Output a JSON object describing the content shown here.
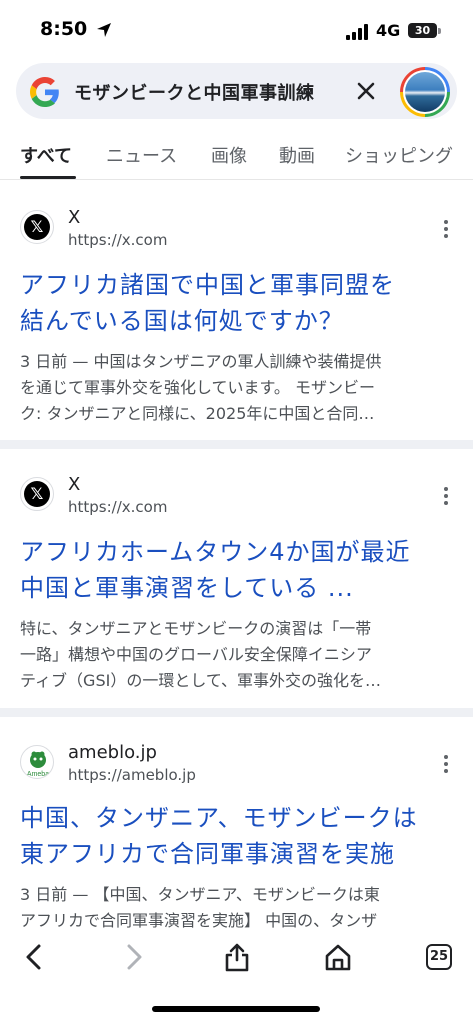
{
  "status_bar": {
    "time": "8:50",
    "network": "4G",
    "battery": "30"
  },
  "search": {
    "query": "モザンビークと中国軍事訓練",
    "logo_icon": "google-g-icon",
    "clear_icon": "close-icon"
  },
  "tabs": [
    {
      "label": "すべて",
      "active": true
    },
    {
      "label": "ニュース",
      "active": false
    },
    {
      "label": "画像",
      "active": false
    },
    {
      "label": "動画",
      "active": false
    },
    {
      "label": "ショッピング",
      "active": false
    }
  ],
  "results": [
    {
      "site_name": "X",
      "site_url": "https://x.com",
      "title_line1": "アフリカ諸国で中国と軍事同盟を",
      "title_line2": "結んでいる国は何処ですか？",
      "snippet_line1": "3 日前 — 中国はタンザニアの軍人訓練や装備提供",
      "snippet_line2": "を通じて軍事外交を強化しています。 モザンビー",
      "snippet_line3": "ク: タンザニアと同様に、2025年に中国と合同…",
      "logo_icon": "x-logo-icon"
    },
    {
      "site_name": "X",
      "site_url": "https://x.com",
      "title_line1": "アフリカホームタウン4か国が最近",
      "title_line2": "中国と軍事演習をしている ...",
      "snippet_line1": "特に、タンザニアとモザンビークの演習は「一帯",
      "snippet_line2": "一路」構想や中国のグローバル安全保障イニシア",
      "snippet_line3": "ティブ（GSI）の一環として、軍事外交の強化を…",
      "logo_icon": "x-logo-icon"
    },
    {
      "site_name": "ameblo.jp",
      "site_url": "https://ameblo.jp",
      "title_line1": "中国、タンザニア、モザンビークは",
      "title_line2": "東アフリカで合同軍事演習を実施",
      "snippet_line1": "3 日前 — 【中国、タンザニア、モザンビークは東",
      "snippet_line2": "アフリカで合同軍事演習を実施】 中国の、タンザ",
      "logo_icon": "ameba-logo-icon",
      "logo_text": "Ameba"
    }
  ],
  "toolbar": {
    "tab_count": "25",
    "icons": [
      "back-icon",
      "forward-icon",
      "share-icon",
      "home-icon",
      "tabs-icon"
    ]
  },
  "colors": {
    "link_blue": "#1a4fbf",
    "search_bg": "#eef0f6",
    "divider": "#eef0f4"
  }
}
